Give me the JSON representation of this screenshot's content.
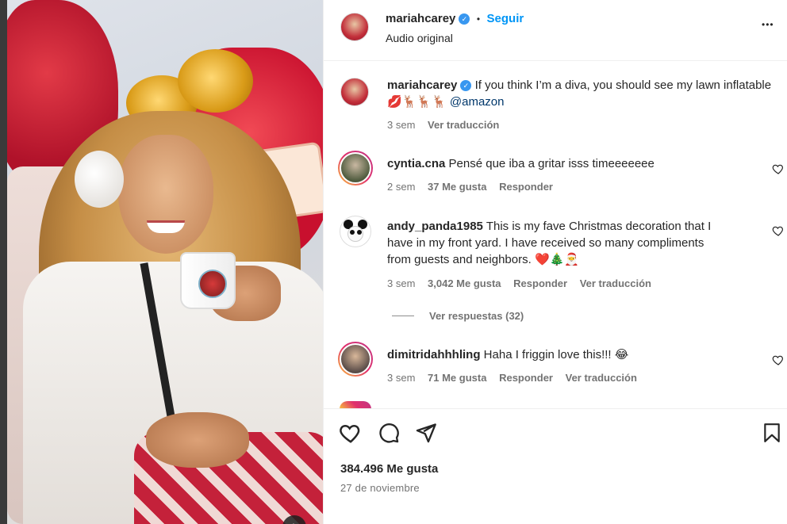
{
  "post": {
    "username": "mariahcarey",
    "follow_label": "Seguir",
    "separator": "•",
    "audio": "Audio original",
    "more": "•••"
  },
  "caption": {
    "username": "mariahcarey",
    "text": "If you think I’m a diva, you should see my lawn inflatable",
    "emojis": "💋🦌🦌🦌",
    "mention": "@amazon",
    "time": "3 sem",
    "translate": "Ver traducción"
  },
  "comments": [
    {
      "username": "cyntia.cna",
      "text": "Pensé que iba a gritar isss timeeeeeee",
      "time": "2 sem",
      "likes": "37 Me gusta",
      "reply": "Responder"
    },
    {
      "username": "andy_panda1985",
      "text_line1": "This is my fave Christmas decoration that I",
      "text_line2": "have in my front yard. I have received so many compliments",
      "text_line3": "from guests and neighbors.",
      "emojis": "❤️🎄🎅",
      "time": "3 sem",
      "likes": "3,042 Me gusta",
      "reply": "Responder",
      "translate": "Ver traducción",
      "view_replies": "Ver respuestas (32)"
    },
    {
      "username": "dimitridahhhling",
      "text": "Haha I friggin love this!!!",
      "emoji": "😂",
      "time": "3 sem",
      "likes": "71 Me gusta",
      "reply": "Responder",
      "translate": "Ver traducción"
    }
  ],
  "footer": {
    "likes": "384.496 Me gusta",
    "date": "27 de noviembre"
  },
  "icons": {
    "verified": "verified-badge-icon",
    "heart": "heart-icon",
    "comment": "comment-icon",
    "share": "share-icon",
    "save": "bookmark-icon",
    "more": "more-options-icon",
    "next": "chevron-right-icon"
  },
  "colors": {
    "link_blue": "#0095f6",
    "mention": "#00376b",
    "muted": "#737373",
    "verified": "#3897f0"
  }
}
